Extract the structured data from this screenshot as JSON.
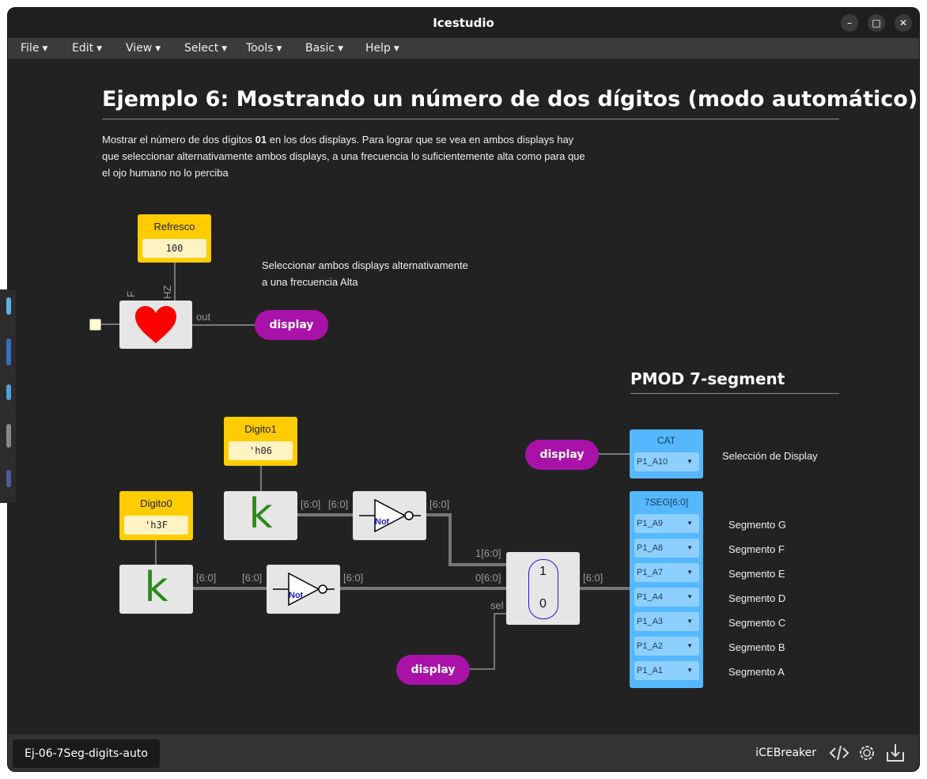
{
  "window": {
    "title": "Icestudio"
  },
  "menu": [
    {
      "label": "File"
    },
    {
      "label": "Edit"
    },
    {
      "label": "View"
    },
    {
      "label": "Select"
    },
    {
      "label": "Tools"
    },
    {
      "label": "Basic"
    },
    {
      "label": "Help"
    }
  ],
  "page": {
    "title": "Ejemplo 6: Mostrando un número de dos dígitos (modo automático)",
    "desc_prefix": "Mostrar el número de dos dígitos ",
    "desc_bold": "01",
    "desc_suffix": " en los dos displays. Para lograr que se vea en ambos displays hay que seleccionar alternativamente ambos displays, a una frecuencia lo suficientemente alta como para que el ojo humano no lo perciba",
    "note_line1": "Seleccionar ambos displays alternativamente",
    "note_line2": "a una frecuencia Alta",
    "pmod_title": "PMOD 7-segment"
  },
  "blocks": {
    "refresco": {
      "label": "Refresco",
      "value": "100"
    },
    "heart": {
      "port_in_f": "F",
      "port_in_hz": "HZ",
      "port_out": "out",
      "icon": "heart-icon"
    },
    "digito1": {
      "label": "Digito1",
      "value": "'h06",
      "symbol": "k"
    },
    "digito0": {
      "label": "Digito0",
      "value": "'h3F",
      "symbol": "k"
    },
    "not_gate": {
      "text": "Not"
    },
    "mux": {
      "in1": "1",
      "in0": "0",
      "label_in1": "1[6:0]",
      "label_in0": "0[6:0]",
      "label_sel": "sel"
    },
    "display_labels": [
      "display",
      "display",
      "display"
    ],
    "cat": {
      "title": "CAT",
      "pin": "P1_A10",
      "note": "Selección de Display"
    },
    "seg": {
      "title": "7SEG[6:0]",
      "pins": [
        "P1_A9",
        "P1_A8",
        "P1_A7",
        "P1_A4",
        "P1_A3",
        "P1_A2",
        "P1_A1"
      ],
      "names": [
        "Segmento G",
        "Segmento F",
        "Segmento E",
        "Segmento D",
        "Segmento C",
        "Segmento B",
        "Segmento A"
      ]
    },
    "bus_label": "[6:0]"
  },
  "status": {
    "file_tab": "Ej-06-7Seg-digits-auto",
    "board": "iCEBreaker",
    "icons": [
      "code-icon",
      "settings-icon",
      "download-icon"
    ]
  },
  "colors": {
    "const_block": "#ffcc00",
    "label_pill": "#a812a8",
    "pin_block": "#55b8ff",
    "background": "#222222"
  }
}
